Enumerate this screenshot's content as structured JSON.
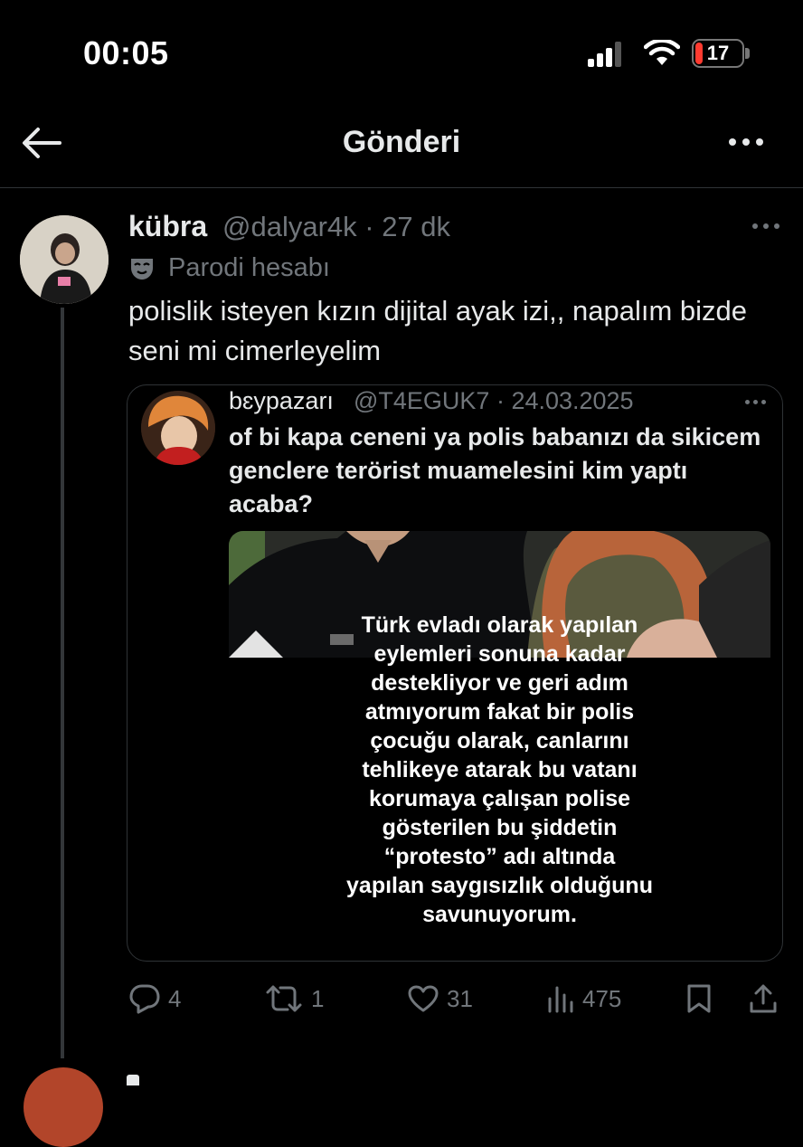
{
  "status_bar": {
    "time": "00:05",
    "battery": "17"
  },
  "header": {
    "title": "Gönderi"
  },
  "tweet": {
    "name": "kübra",
    "handle": "@dalyar4k · 27 dk",
    "badge": "Parodi hesabı",
    "text": "polislik isteyen kızın dijital ayak izi,, napalım bizde seni mi cimerleyelim",
    "quote": {
      "name": "bɛypazarı",
      "handle": "@T4EGUK7 · 24.03.2025",
      "text": "of bi kapa ceneni ya polis babanızı da sikicem genclere terörist muamelesini kim yaptı acaba?",
      "media_caption": [
        "Türk evladı olarak yapılan",
        "eylemleri sonuna kadar",
        "destekliyor ve geri adım",
        "atmıyorum fakat bir polis",
        "çocuğu olarak, canlarını",
        "tehlikeye atarak bu vatanı",
        "korumaya çalışan polise",
        "gösterilen bu şiddetin",
        "“protesto” adı altında",
        "yapılan saygısızlık olduğunu",
        "savunuyorum."
      ]
    },
    "actions": {
      "replies": "4",
      "reposts": "1",
      "likes": "31",
      "views": "475"
    }
  },
  "colors": {
    "background": "#000000",
    "text": "#e7e9ea",
    "muted": "#71767b",
    "divider": "#2f3336",
    "battery_low": "#ff3b30"
  },
  "icons": [
    "signal-icon",
    "wifi-icon",
    "battery-icon",
    "back-arrow-icon",
    "more-icon",
    "parody-mask-icon",
    "reply-icon",
    "repost-icon",
    "like-icon",
    "views-icon",
    "bookmark-icon",
    "share-icon"
  ]
}
